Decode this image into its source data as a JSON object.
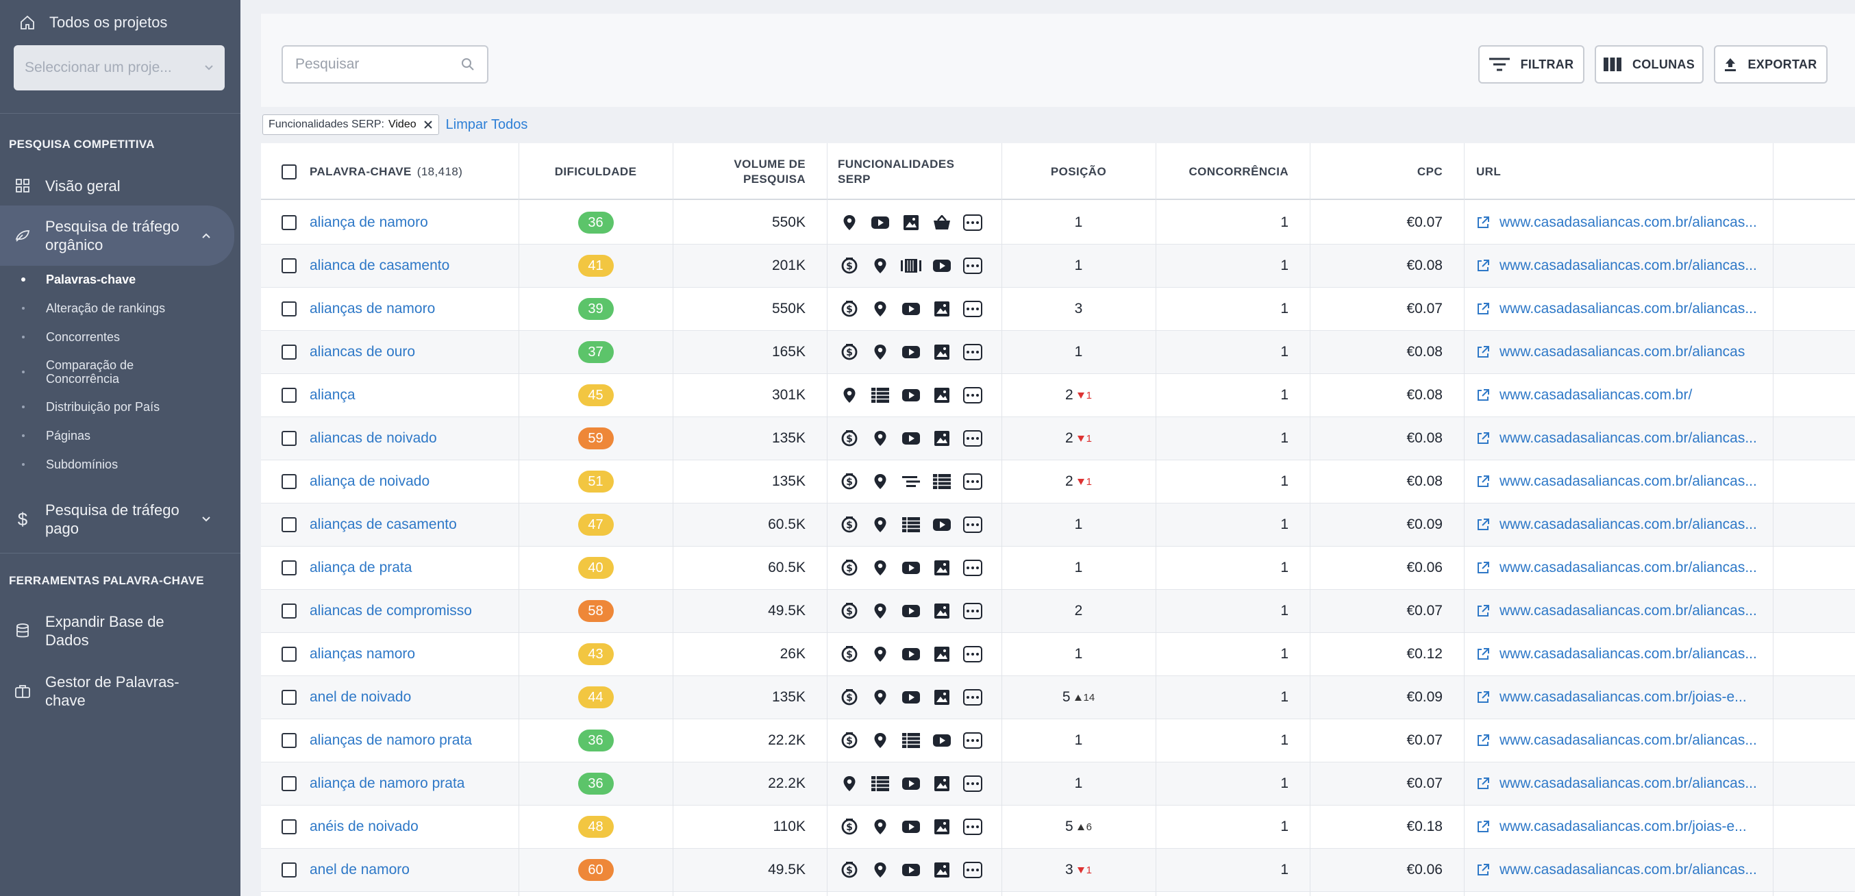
{
  "sidebar": {
    "all_projects": "Todos os projetos",
    "project_select_placeholder": "Seleccionar um proje...",
    "section_competitive": "PESQUISA COMPETITIVA",
    "overview": "Visão geral",
    "organic": "Pesquisa de tráfego orgânico",
    "organic_subitems": [
      "Palavras-chave",
      "Alteração de rankings",
      "Concorrentes",
      "Comparação de Concorrência",
      "Distribuição por País",
      "Páginas",
      "Subdomínios"
    ],
    "paid": "Pesquisa de tráfego pago",
    "section_tools": "FERRAMENTAS PALAVRA-CHAVE",
    "expand_db": "Expandir Base de Dados",
    "kw_manager": "Gestor de Palavras-chave"
  },
  "toolbar": {
    "search_placeholder": "Pesquisar",
    "filter_label": "FILTRAR",
    "columns_label": "COLUNAS",
    "export_label": "EXPORTAR"
  },
  "filters": {
    "chip_label": "Funcionalidades SERP:",
    "chip_value": "Video",
    "clear_all": "Limpar Todos"
  },
  "table": {
    "headers": {
      "keyword": "PALAVRA-CHAVE",
      "keyword_count": "(18,418)",
      "difficulty": "DIFICULDADE",
      "volume_line1": "VOLUME DE",
      "volume_line2": "PESQUISA",
      "serp_line1": "FUNCIONALIDADES",
      "serp_line2": "SERP",
      "position": "POSIÇÃO",
      "competition": "CONCORRÊNCIA",
      "cpc": "CPC",
      "url": "URL"
    },
    "colors": {
      "green": "#5cc46a",
      "yellow": "#f2c641",
      "orange": "#ee8738"
    },
    "rows": [
      {
        "keyword": "aliança de namoro",
        "difficulty": "36",
        "diff_color": "green",
        "volume": "550K",
        "serp": [
          "pin",
          "youtube",
          "image",
          "basket"
        ],
        "position": "1",
        "change": "",
        "dir": "",
        "competition": "1",
        "cpc": "€0.07",
        "url": "www.casadasaliancas.com.br/aliancas..."
      },
      {
        "keyword": "alianca de casamento",
        "difficulty": "41",
        "diff_color": "yellow",
        "volume": "201K",
        "serp": [
          "money",
          "pin",
          "carousel",
          "youtube"
        ],
        "position": "1",
        "change": "",
        "dir": "",
        "competition": "1",
        "cpc": "€0.08",
        "url": "www.casadasaliancas.com.br/aliancas..."
      },
      {
        "keyword": "alianças de namoro",
        "difficulty": "39",
        "diff_color": "green",
        "volume": "550K",
        "serp": [
          "money",
          "pin",
          "youtube",
          "image"
        ],
        "position": "3",
        "change": "",
        "dir": "",
        "competition": "1",
        "cpc": "€0.07",
        "url": "www.casadasaliancas.com.br/aliancas..."
      },
      {
        "keyword": "aliancas de ouro",
        "difficulty": "37",
        "diff_color": "green",
        "volume": "165K",
        "serp": [
          "money",
          "pin",
          "youtube",
          "image"
        ],
        "position": "1",
        "change": "",
        "dir": "",
        "competition": "1",
        "cpc": "€0.08",
        "url": "www.casadasaliancas.com.br/aliancas"
      },
      {
        "keyword": "aliança",
        "difficulty": "45",
        "diff_color": "yellow",
        "volume": "301K",
        "serp": [
          "pin",
          "table",
          "youtube",
          "image"
        ],
        "position": "2",
        "change": "1",
        "dir": "down",
        "competition": "1",
        "cpc": "€0.08",
        "url": "www.casadasaliancas.com.br/"
      },
      {
        "keyword": "aliancas de noivado",
        "difficulty": "59",
        "diff_color": "orange",
        "volume": "135K",
        "serp": [
          "money",
          "pin",
          "youtube",
          "image"
        ],
        "position": "2",
        "change": "1",
        "dir": "down",
        "competition": "1",
        "cpc": "€0.08",
        "url": "www.casadasaliancas.com.br/aliancas..."
      },
      {
        "keyword": "aliança de noivado",
        "difficulty": "51",
        "diff_color": "yellow",
        "volume": "135K",
        "serp": [
          "money",
          "pin",
          "snippet",
          "table"
        ],
        "position": "2",
        "change": "1",
        "dir": "down",
        "competition": "1",
        "cpc": "€0.08",
        "url": "www.casadasaliancas.com.br/aliancas..."
      },
      {
        "keyword": "alianças de casamento",
        "difficulty": "47",
        "diff_color": "yellow",
        "volume": "60.5K",
        "serp": [
          "money",
          "pin",
          "table",
          "youtube"
        ],
        "position": "1",
        "change": "",
        "dir": "",
        "competition": "1",
        "cpc": "€0.09",
        "url": "www.casadasaliancas.com.br/aliancas..."
      },
      {
        "keyword": "aliança de prata",
        "difficulty": "40",
        "diff_color": "yellow",
        "volume": "60.5K",
        "serp": [
          "money",
          "pin",
          "youtube",
          "image"
        ],
        "position": "1",
        "change": "",
        "dir": "",
        "competition": "1",
        "cpc": "€0.06",
        "url": "www.casadasaliancas.com.br/aliancas..."
      },
      {
        "keyword": "aliancas de compromisso",
        "difficulty": "58",
        "diff_color": "orange",
        "volume": "49.5K",
        "serp": [
          "money",
          "pin",
          "youtube",
          "image"
        ],
        "position": "2",
        "change": "",
        "dir": "",
        "competition": "1",
        "cpc": "€0.07",
        "url": "www.casadasaliancas.com.br/aliancas..."
      },
      {
        "keyword": "alianças namoro",
        "difficulty": "43",
        "diff_color": "yellow",
        "volume": "26K",
        "serp": [
          "money",
          "pin",
          "youtube",
          "image"
        ],
        "position": "1",
        "change": "",
        "dir": "",
        "competition": "1",
        "cpc": "€0.12",
        "url": "www.casadasaliancas.com.br/aliancas..."
      },
      {
        "keyword": "anel de noivado",
        "difficulty": "44",
        "diff_color": "yellow",
        "volume": "135K",
        "serp": [
          "money",
          "pin",
          "youtube",
          "image"
        ],
        "position": "5",
        "change": "14",
        "dir": "up",
        "competition": "1",
        "cpc": "€0.09",
        "url": "www.casadasaliancas.com.br/joias-e..."
      },
      {
        "keyword": "alianças de namoro prata",
        "difficulty": "36",
        "diff_color": "green",
        "volume": "22.2K",
        "serp": [
          "money",
          "pin",
          "table",
          "youtube"
        ],
        "position": "1",
        "change": "",
        "dir": "",
        "competition": "1",
        "cpc": "€0.07",
        "url": "www.casadasaliancas.com.br/aliancas..."
      },
      {
        "keyword": "aliança de namoro prata",
        "difficulty": "36",
        "diff_color": "green",
        "volume": "22.2K",
        "serp": [
          "pin",
          "table",
          "youtube",
          "image"
        ],
        "position": "1",
        "change": "",
        "dir": "",
        "competition": "1",
        "cpc": "€0.07",
        "url": "www.casadasaliancas.com.br/aliancas..."
      },
      {
        "keyword": "anéis de noivado",
        "difficulty": "48",
        "diff_color": "yellow",
        "volume": "110K",
        "serp": [
          "money",
          "pin",
          "youtube",
          "image"
        ],
        "position": "5",
        "change": "6",
        "dir": "up",
        "competition": "1",
        "cpc": "€0.18",
        "url": "www.casadasaliancas.com.br/joias-e..."
      },
      {
        "keyword": "anel de namoro",
        "difficulty": "60",
        "diff_color": "orange",
        "volume": "49.5K",
        "serp": [
          "money",
          "pin",
          "youtube",
          "image"
        ],
        "position": "3",
        "change": "1",
        "dir": "down",
        "competition": "1",
        "cpc": "€0.06",
        "url": "www.casadasaliancas.com.br/aliancas..."
      }
    ]
  }
}
